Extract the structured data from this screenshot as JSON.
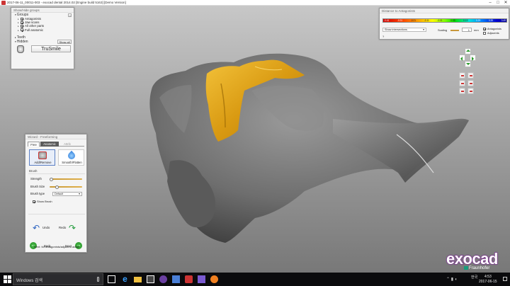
{
  "window": {
    "title": "2017-06-11_00011-003 - exocad dental 2014.02 [Engine build 5163] [Demo Version]",
    "minimize": "–",
    "maximize": "□",
    "close": "✕"
  },
  "show_hide_panel": {
    "title": "Show/Hide groups",
    "groups_header": "Groups",
    "help": "?",
    "groups": [
      {
        "label": "Antagonists",
        "checked": true
      },
      {
        "label": "Jaw scans",
        "checked": true
      },
      {
        "label": "All other parts",
        "checked": true
      },
      {
        "label": "Full anatomic",
        "checked": true
      }
    ],
    "teeth_header": "Teeth",
    "hidden_header": "Hidden",
    "show_all": "Show all",
    "trusmile": "TruSmile"
  },
  "distance_panel": {
    "title": "Distance to Antagonists",
    "scale_labels": [
      "-0.41",
      "-0.31",
      "-0.21",
      "-0.11",
      "-0.01",
      "0.09",
      "0.19",
      "0.29",
      "0.39",
      "0.49"
    ],
    "show_intersections": "Show intersections",
    "scaling_label": "Scaling",
    "scaling_value": "1",
    "unit": "mm",
    "antagonists": "Antagonists",
    "adjacents": "Adjacents",
    "help": "?"
  },
  "wizard": {
    "title": "Wizard - Freeforming",
    "tabs": [
      "Free",
      "Anatomic",
      "Attrib"
    ],
    "tool_add": "Add/Remove",
    "tool_smooth": "Smooth/Flatten",
    "brush_header": "Brush",
    "strength": "Strength",
    "brush_size": "Brush Size",
    "brush_type": "Brush type",
    "brush_type_value": "Default",
    "show_brush": "Show Brush",
    "strength_value": 0.05,
    "brush_size_value": 0.22,
    "undo": "Undo",
    "redo": "Redo",
    "back": "Back",
    "next": "Next",
    "footer": "Next: for antagonists/adjacent adapt"
  },
  "brand": {
    "logo": "exocad",
    "sub": "Fraunhofer"
  },
  "taskbar": {
    "search": "Windows 검색",
    "lang": "한국",
    "time": "4:53",
    "date": "2017-06-15"
  },
  "colors": {
    "tooth": "#e0a51c",
    "gum": "#6f6f6f",
    "logo": "#7a2f8f"
  }
}
